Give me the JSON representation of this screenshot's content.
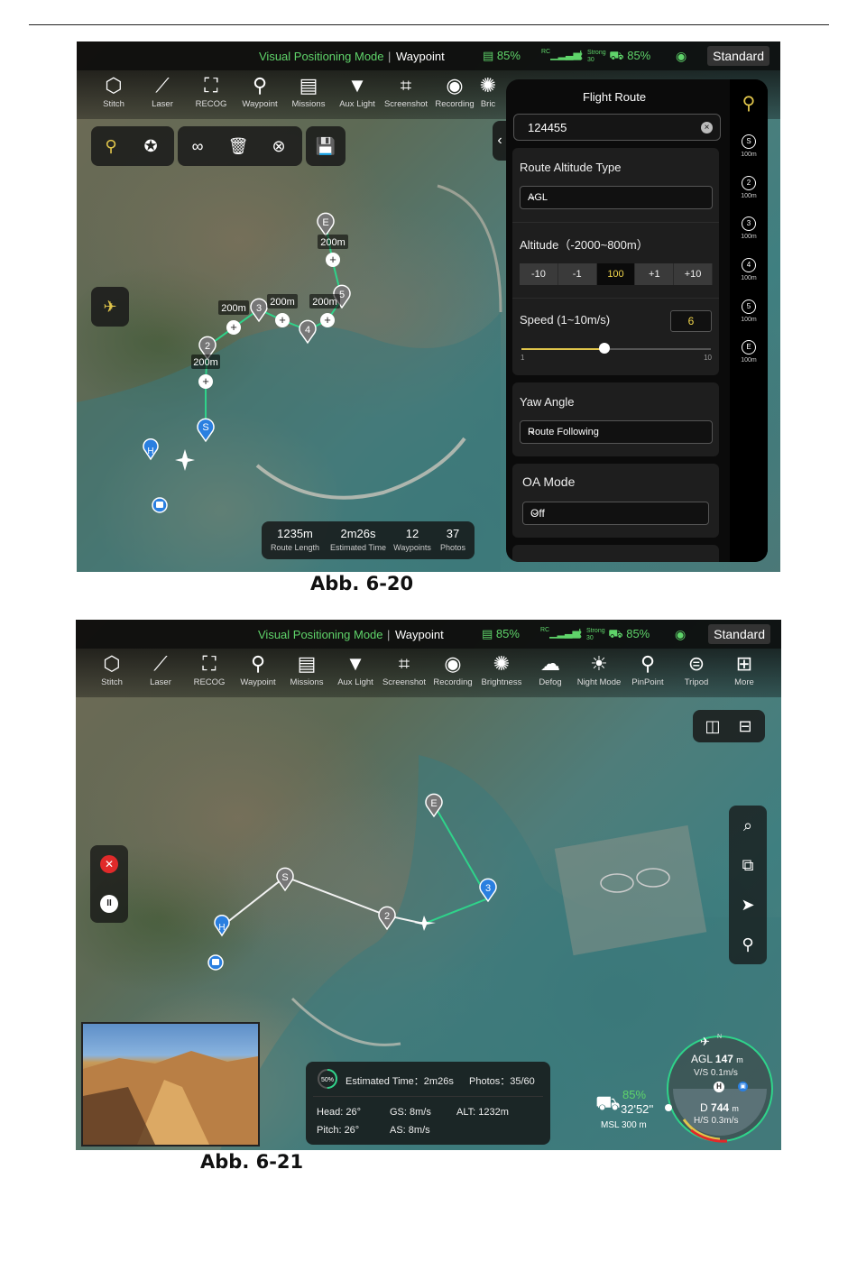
{
  "status_bar": {
    "mode": "Visual Positioning Mode",
    "separator": "|",
    "flight_type": "Waypoint",
    "battery_aircraft": "85%",
    "rc_label": "RC",
    "signal_label": "Strong",
    "signal_value": "30",
    "battery_rc": "85%",
    "profile": "Standard"
  },
  "toolbar": {
    "items": [
      {
        "label": "Stitch",
        "icon": "stitch-icon"
      },
      {
        "label": "Laser",
        "icon": "laser-icon"
      },
      {
        "label": "RECOG",
        "icon": "recog-icon"
      },
      {
        "label": "Waypoint",
        "icon": "waypoint-icon"
      },
      {
        "label": "Missions",
        "icon": "missions-icon"
      },
      {
        "label": "Aux Light",
        "icon": "aux-light-icon"
      },
      {
        "label": "Screenshot",
        "icon": "screenshot-icon"
      },
      {
        "label": "Recording",
        "icon": "recording-icon"
      },
      {
        "label": "Brightness",
        "icon": "brightness-icon"
      },
      {
        "label": "Defog",
        "icon": "defog-icon"
      },
      {
        "label": "Night Mode",
        "icon": "night-mode-icon"
      },
      {
        "label": "PinPoint",
        "icon": "pinpoint-icon"
      },
      {
        "label": "Tripod",
        "icon": "tripod-icon"
      },
      {
        "label": "More",
        "icon": "more-icon"
      }
    ],
    "truncated_label": "Bric"
  },
  "route_panel": {
    "title": "Flight Route",
    "route_name": "124455",
    "altitude_type_label": "Route Altitude Type",
    "altitude_type_value": "AGL",
    "altitude_label": "Altitude（-2000~800m）",
    "altitude_steps": [
      "-10",
      "-1",
      "100",
      "+1",
      "+10"
    ],
    "speed_label": "Speed (1~10m/s)",
    "speed_value": "6",
    "speed_min": "1",
    "speed_max": "10",
    "speed_fraction": 0.44,
    "yaw_label": "Yaw Angle",
    "yaw_value": "Route Following",
    "oa_label": "OA Mode",
    "oa_value": "Off",
    "waypoints": [
      {
        "id": "S",
        "alt": "100m"
      },
      {
        "id": "2",
        "alt": "100m"
      },
      {
        "id": "3",
        "alt": "100m"
      },
      {
        "id": "4",
        "alt": "100m"
      },
      {
        "id": "5",
        "alt": "100m"
      },
      {
        "id": "E",
        "alt": "100m"
      }
    ]
  },
  "map1": {
    "segment_label": "200m",
    "markers": [
      "S",
      "2",
      "3",
      "4",
      "5",
      "E",
      "H"
    ]
  },
  "route_stats": {
    "length_value": "1235m",
    "length_label": "Route Length",
    "time_value": "2m26s",
    "time_label": "Estimated Time",
    "waypoints_value": "12",
    "waypoints_label": "Waypoints",
    "photos_value": "37",
    "photos_label": "Photos"
  },
  "caption1": "Abb. 6-20",
  "caption2": "Abb. 6-21",
  "mission_info": {
    "progress": "50%",
    "progress_fraction": 0.5,
    "estimated_time": "Estimated Time：2m26s",
    "photos": "Photos：35/60",
    "head": "Head: 26°",
    "pitch": "Pitch: 26°",
    "gs": "GS: 8m/s",
    "as": "AS: 8m/s",
    "alt": "ALT: 1232m"
  },
  "map2": {
    "markers": [
      "S",
      "2",
      "3",
      "E",
      "H"
    ]
  },
  "telemetry": {
    "battery": "85%",
    "flight_time": "32'52''",
    "msl": "MSL 300 m",
    "north": "N",
    "agl_label": "AGL",
    "agl_value": "147",
    "agl_unit": "m",
    "vs": "V/S 0.1m/s",
    "d_label": "D",
    "d_value": "744",
    "d_unit": "m",
    "hs": "H/S 0.3m/s",
    "home": "H"
  },
  "colors": {
    "accent_green": "#5fd46a",
    "route_green": "#2fd38a",
    "value_yellow": "#f1d54b",
    "marker_blue": "#2a7fe0"
  }
}
